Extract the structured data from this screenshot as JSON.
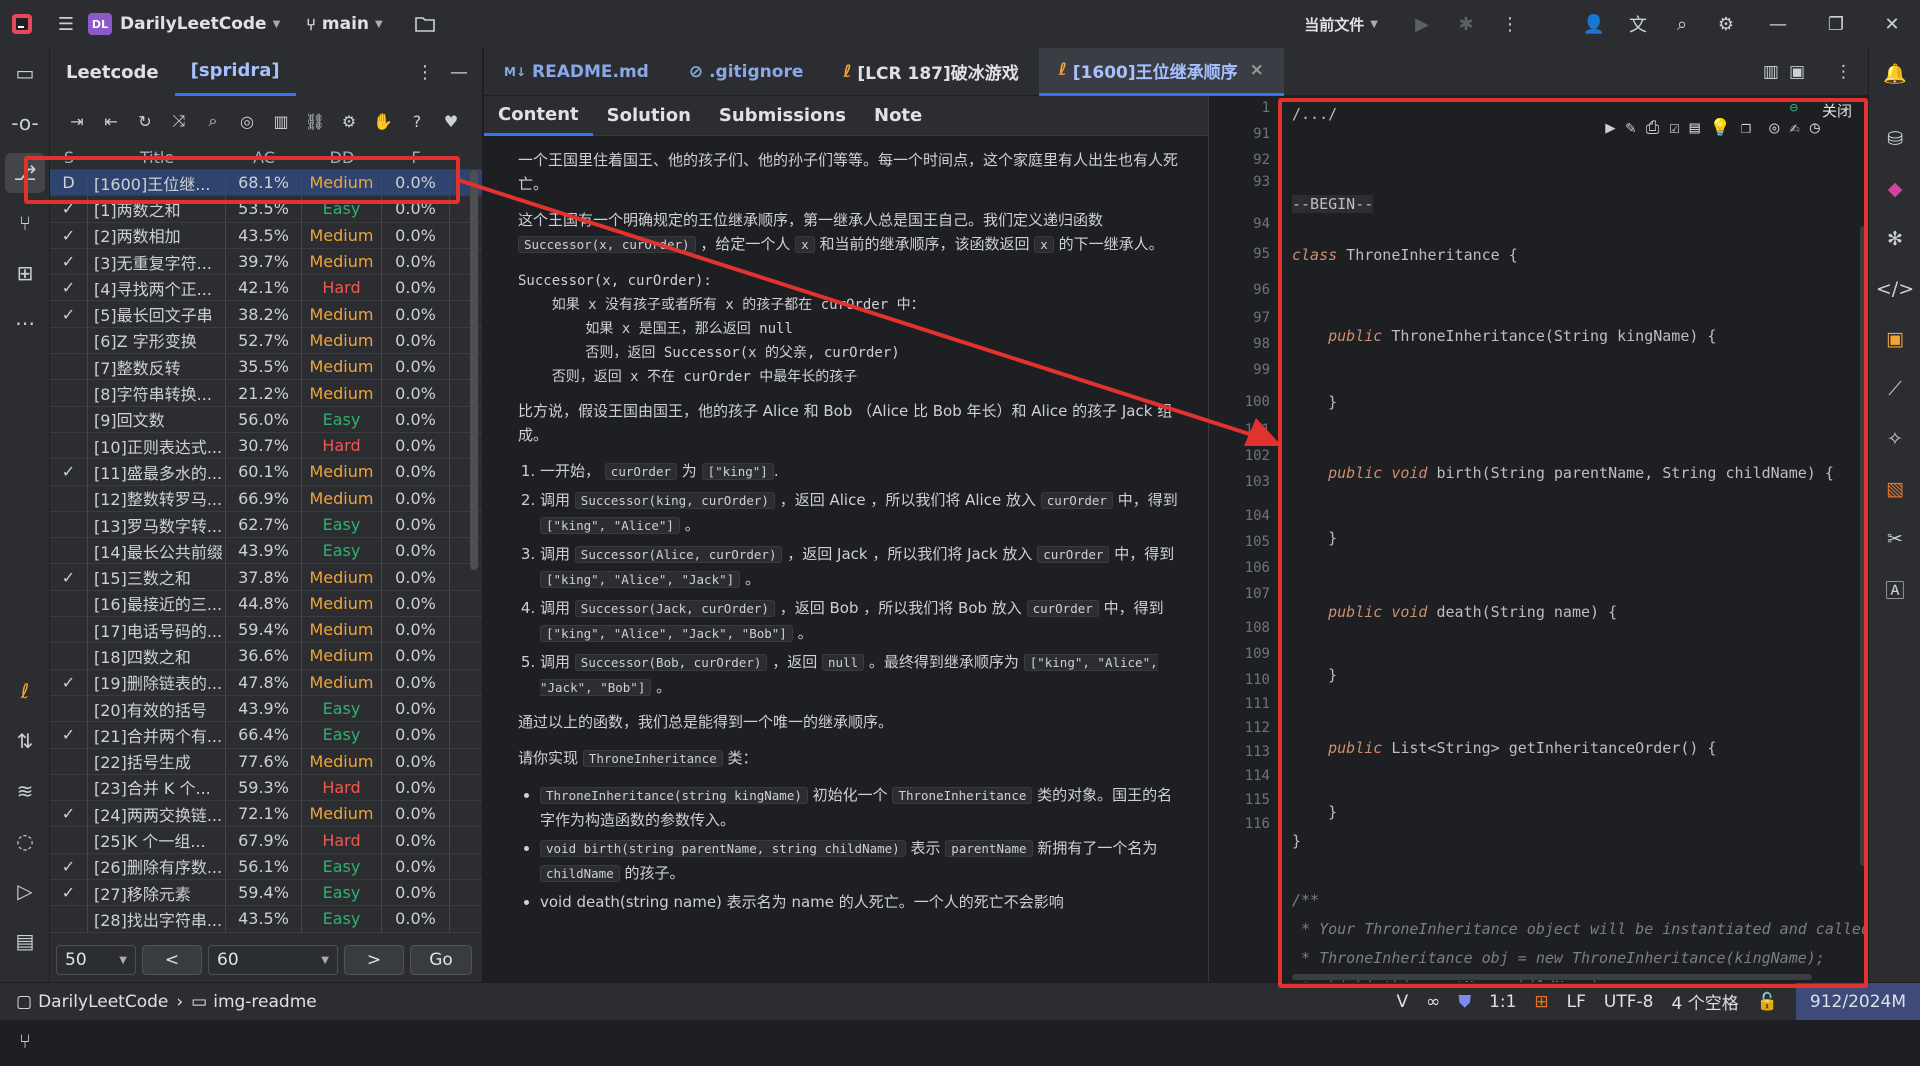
{
  "titlebar": {
    "project_initials": "DL",
    "project": "DarilyLeetCode",
    "branch": "main",
    "current_file": "当前文件"
  },
  "lc": {
    "tab1": "Leetcode",
    "tab2": "[spridra]",
    "headers": [
      "S",
      "Title",
      "AC",
      "DD",
      "F"
    ],
    "rows": [
      {
        "s": "D",
        "title": "[1600]王位继...",
        "ac": "68.1%",
        "dd": "Medium",
        "f": "0.0%"
      },
      {
        "s": "✓",
        "title": "[1]两数之和",
        "ac": "53.5%",
        "dd": "Easy",
        "f": "0.0%"
      },
      {
        "s": "✓",
        "title": "[2]两数相加",
        "ac": "43.5%",
        "dd": "Medium",
        "f": "0.0%"
      },
      {
        "s": "✓",
        "title": "[3]无重复字符...",
        "ac": "39.7%",
        "dd": "Medium",
        "f": "0.0%"
      },
      {
        "s": "✓",
        "title": "[4]寻找两个正...",
        "ac": "42.1%",
        "dd": "Hard",
        "f": "0.0%"
      },
      {
        "s": "✓",
        "title": "[5]最长回文子串",
        "ac": "38.2%",
        "dd": "Medium",
        "f": "0.0%"
      },
      {
        "s": "",
        "title": "[6]Z 字形变换",
        "ac": "52.7%",
        "dd": "Medium",
        "f": "0.0%"
      },
      {
        "s": "",
        "title": "[7]整数反转",
        "ac": "35.5%",
        "dd": "Medium",
        "f": "0.0%"
      },
      {
        "s": "",
        "title": "[8]字符串转换...",
        "ac": "21.2%",
        "dd": "Medium",
        "f": "0.0%"
      },
      {
        "s": "",
        "title": "[9]回文数",
        "ac": "56.0%",
        "dd": "Easy",
        "f": "0.0%"
      },
      {
        "s": "",
        "title": "[10]正则表达式...",
        "ac": "30.7%",
        "dd": "Hard",
        "f": "0.0%"
      },
      {
        "s": "✓",
        "title": "[11]盛最多水的...",
        "ac": "60.1%",
        "dd": "Medium",
        "f": "0.0%"
      },
      {
        "s": "",
        "title": "[12]整数转罗马...",
        "ac": "66.9%",
        "dd": "Medium",
        "f": "0.0%"
      },
      {
        "s": "",
        "title": "[13]罗马数字转...",
        "ac": "62.7%",
        "dd": "Easy",
        "f": "0.0%"
      },
      {
        "s": "",
        "title": "[14]最长公共前缀",
        "ac": "43.9%",
        "dd": "Easy",
        "f": "0.0%"
      },
      {
        "s": "✓",
        "title": "[15]三数之和",
        "ac": "37.8%",
        "dd": "Medium",
        "f": "0.0%"
      },
      {
        "s": "",
        "title": "[16]最接近的三...",
        "ac": "44.8%",
        "dd": "Medium",
        "f": "0.0%"
      },
      {
        "s": "",
        "title": "[17]电话号码的...",
        "ac": "59.4%",
        "dd": "Medium",
        "f": "0.0%"
      },
      {
        "s": "",
        "title": "[18]四数之和",
        "ac": "36.6%",
        "dd": "Medium",
        "f": "0.0%"
      },
      {
        "s": "✓",
        "title": "[19]删除链表的...",
        "ac": "47.8%",
        "dd": "Medium",
        "f": "0.0%"
      },
      {
        "s": "",
        "title": "[20]有效的括号",
        "ac": "43.9%",
        "dd": "Easy",
        "f": "0.0%"
      },
      {
        "s": "✓",
        "title": "[21]合并两个有...",
        "ac": "66.4%",
        "dd": "Easy",
        "f": "0.0%"
      },
      {
        "s": "",
        "title": "[22]括号生成",
        "ac": "77.6%",
        "dd": "Medium",
        "f": "0.0%"
      },
      {
        "s": "",
        "title": "[23]合并 K 个...",
        "ac": "59.3%",
        "dd": "Hard",
        "f": "0.0%"
      },
      {
        "s": "✓",
        "title": "[24]两两交换链...",
        "ac": "72.1%",
        "dd": "Medium",
        "f": "0.0%"
      },
      {
        "s": "",
        "title": "[25]K 个一组...",
        "ac": "67.9%",
        "dd": "Hard",
        "f": "0.0%"
      },
      {
        "s": "✓",
        "title": "[26]删除有序数...",
        "ac": "56.1%",
        "dd": "Easy",
        "f": "0.0%"
      },
      {
        "s": "✓",
        "title": "[27]移除元素",
        "ac": "59.4%",
        "dd": "Easy",
        "f": "0.0%"
      },
      {
        "s": "",
        "title": "[28]找出字符串...",
        "ac": "43.5%",
        "dd": "Easy",
        "f": "0.0%"
      }
    ],
    "pager": {
      "page_size": "50",
      "prev": "<",
      "page": "60",
      "next": ">",
      "go": "Go"
    }
  },
  "tabs": [
    {
      "label": "README.md",
      "icon": "markdown-icon"
    },
    {
      "label": ".gitignore",
      "icon": "ignore-icon"
    },
    {
      "label": "[LCR 187]破冰游戏",
      "icon": "leetcode-file-icon"
    },
    {
      "label": "[1600]王位继承顺序",
      "icon": "leetcode-file-icon",
      "close": "×"
    }
  ],
  "desc": {
    "tabs": [
      "Content",
      "Solution",
      "Submissions",
      "Note"
    ],
    "p1": "一个王国里住着国王、他的孩子们、他的孙子们等等。每一个时间点，这个家庭里有人出生也有人死亡。",
    "p2a": "这个王国有一个明确规定的王位继承顺序，第一继承人总是国王自己。我们定义递归函数",
    "p2code1": "Successor(x, curOrder)",
    "p2b": "，给定一个人",
    "p2code2": "x",
    "p2c": "和当前的继承顺序，该函数返回",
    "p2code3": "x",
    "p2d": "的下一继承人。",
    "pre": "Successor(x, curOrder):\n    如果 x 没有孩子或者所有 x 的孩子都在 curOrder 中：\n        如果 x 是国王，那么返回 null\n        否则，返回 Successor(x 的父亲, curOrder)\n    否则，返回 x 不在 curOrder 中最年长的孩子",
    "p3": "比方说，假设王国由国王，他的孩子 Alice 和 Bob （Alice 比 Bob 年长）和 Alice 的孩子 Jack 组成。",
    "ol1a": "一开始，",
    "ol1c1": "curOrder",
    "ol1b": "为",
    "ol1c2": "[\"king\"]",
    "ol1d": ".",
    "ol2a": "调用",
    "ol2c1": "Successor(king, curOrder)",
    "ol2b": "，返回 Alice ，所以我们将 Alice 放入",
    "ol2c2": "curOrder",
    "ol2c": "中，得到",
    "ol2c3": "[\"king\", \"Alice\"]",
    "ol2d": "。",
    "ol3a": "调用",
    "ol3c1": "Successor(Alice, curOrder)",
    "ol3b": "，返回 Jack ，所以我们将 Jack 放入",
    "ol3c2": "curOrder",
    "ol3c": "中，得到",
    "ol3c3": "[\"king\", \"Alice\", \"Jack\"]",
    "ol3d": "。",
    "ol4a": "调用",
    "ol4c1": "Successor(Jack, curOrder)",
    "ol4b": "，返回 Bob ，所以我们将 Bob 放入",
    "ol4c2": "curOrder",
    "ol4c": "中，得到",
    "ol4c3": "[\"king\", \"Alice\", \"Jack\", \"Bob\"]",
    "ol4d": "。",
    "ol5a": "调用",
    "ol5c1": "Successor(Bob, curOrder)",
    "ol5b": "，返回",
    "ol5c2": "null",
    "ol5c": "。最终得到继承顺序为",
    "ol5c3": "[\"king\", \"Alice\", \"Jack\", \"Bob\"]",
    "ol5d": "。",
    "p4": "通过以上的函数，我们总是能得到一个唯一的继承顺序。",
    "p5a": "请你实现",
    "p5c": "ThroneInheritance",
    "p5b": "类：",
    "ul1c1": "ThroneInheritance(string kingName)",
    "ul1a": "初始化一个",
    "ul1c2": "ThroneInheritance",
    "ul1b": "类的对象。国王的名字作为构造函数的参数传入。",
    "ul2c1": "void birth(string parentName, string childName)",
    "ul2a": "表示",
    "ul2c2": "parentName",
    "ul2b": "新拥有了一个名为",
    "ul2c3": "childName",
    "ul2d": "的孩子。",
    "ul3": "void death(string name)  表示名为 name 的人死亡。一个人的死亡不会影响"
  },
  "code": {
    "close": "关闭",
    "lines": [
      {
        "n": "1",
        "t": "/.../"
      },
      {
        "n": "91",
        "t": ""
      },
      {
        "n": "92",
        "t": ""
      },
      {
        "n": "93",
        "t": "--BEGIN--"
      },
      {
        "n": "94",
        "t": "class ThroneInheritance {"
      },
      {
        "n": "95",
        "t": ""
      },
      {
        "n": "96",
        "t": "    public ThroneInheritance(String kingName) {"
      },
      {
        "n": "97",
        "t": ""
      },
      {
        "n": "98",
        "t": "    }"
      },
      {
        "n": "99",
        "t": ""
      },
      {
        "n": "100",
        "t": "    public void birth(String parentName, String childName) {"
      },
      {
        "n": "101",
        "t": ""
      },
      {
        "n": "102",
        "t": "    }"
      },
      {
        "n": "103",
        "t": ""
      },
      {
        "n": "104",
        "t": "    public void death(String name) {"
      },
      {
        "n": "105",
        "t": ""
      },
      {
        "n": "106",
        "t": "    }"
      },
      {
        "n": "107",
        "t": ""
      },
      {
        "n": "108",
        "t": "    public List<String> getInheritanceOrder() {"
      },
      {
        "n": "109",
        "t": ""
      },
      {
        "n": "110",
        "t": "    }"
      },
      {
        "n": "111",
        "t": "}"
      },
      {
        "n": "112",
        "t": ""
      },
      {
        "n": "113",
        "t": "/**"
      },
      {
        "n": "114",
        "t": " * Your ThroneInheritance object will be instantiated and called as such:"
      },
      {
        "n": "115",
        "t": " * ThroneInheritance obj = new ThroneInheritance(kingName);"
      },
      {
        "n": "116",
        "t": " * obj.birth(parentName,childName);"
      }
    ]
  },
  "status": {
    "project": "DarilyLeetCode",
    "folder": "img-readme",
    "pos": "1:1",
    "eol": "LF",
    "enc": "UTF-8",
    "indent": "4 个空格",
    "mem": "912/2024M"
  },
  "colors": {
    "accent": "#3574f0",
    "annotation": "#e0322f",
    "easy": "#2fb16f",
    "medium": "#f0a43a",
    "hard": "#f2584f"
  }
}
